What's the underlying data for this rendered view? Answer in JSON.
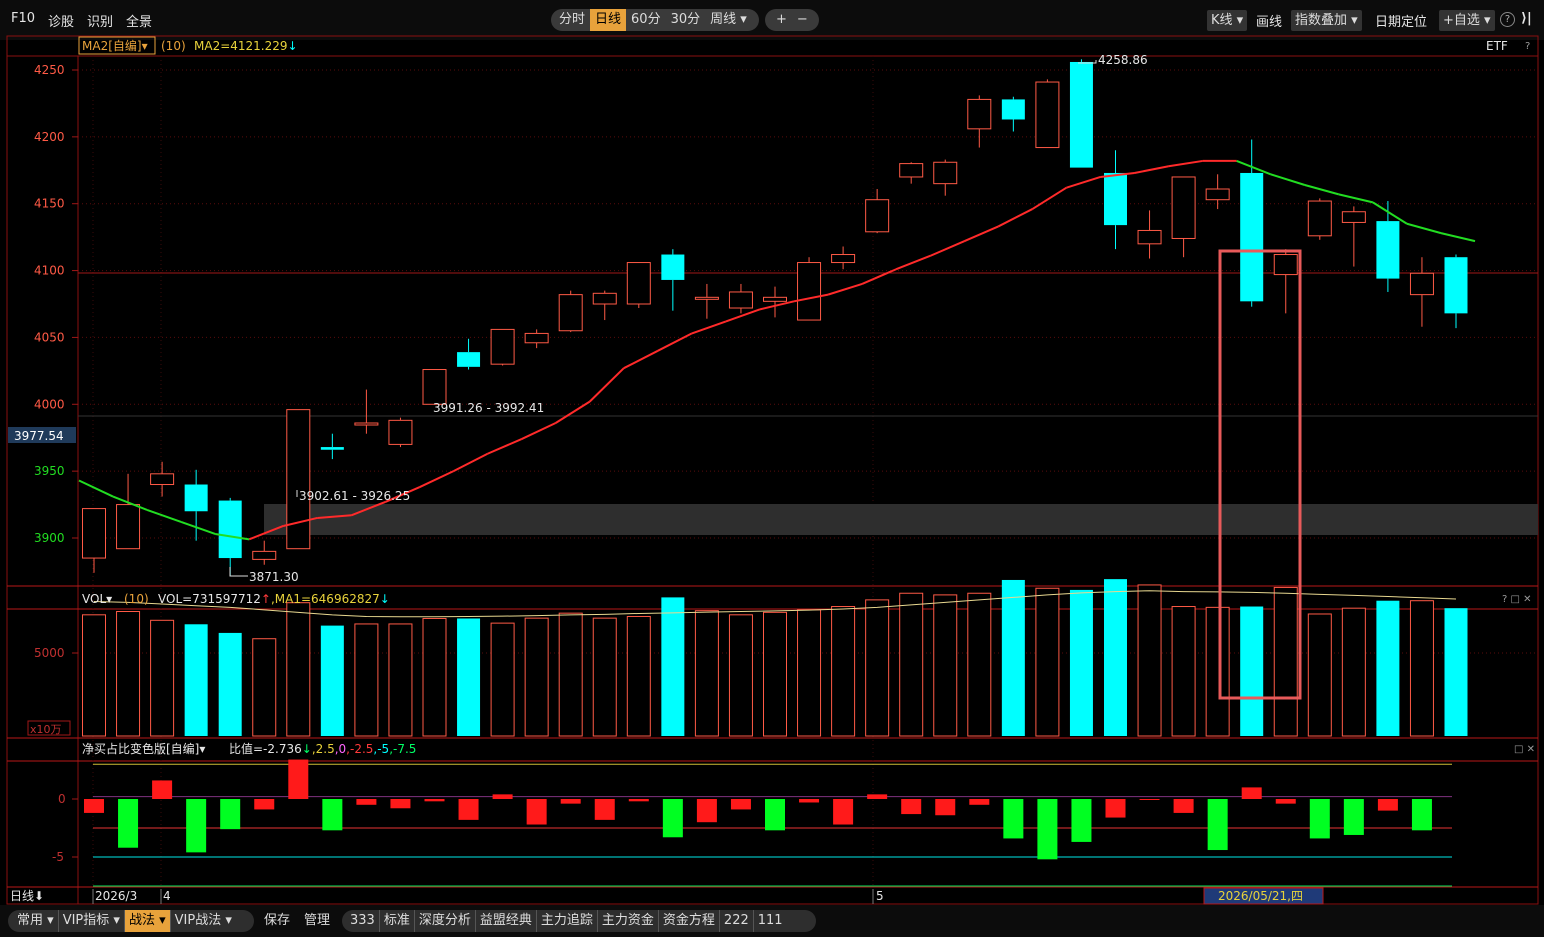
{
  "toolbar": {
    "left_items": [
      "F10",
      "诊股",
      "识别",
      "全景"
    ],
    "periods": [
      "分时",
      "日线",
      "60分",
      "30分",
      "周线"
    ],
    "active_period": "日线",
    "plus": "+",
    "minus": "−",
    "kline_btn": "K线",
    "draw_btn": "画线",
    "overlay_btn": "指数叠加",
    "date_locate": "日期定位",
    "watchlist_btn": "+自选",
    "help": "?",
    "collapse": "⟩|"
  },
  "main_panel": {
    "indicator_name": "MA2[自编]",
    "indicator_param": "(10)",
    "indicator_value": "MA2=4121.229",
    "indicator_arrow": "↓",
    "etf_label": "ETF",
    "help": "?",
    "current_price_label": "3977.54",
    "annotations": {
      "high": "4258.86",
      "low": "3871.30",
      "zone1": "3902.61 - 3926.25",
      "zone2": "3991.26 - 3992.41"
    }
  },
  "vol_panel": {
    "name": "VOL",
    "param": "(10)",
    "vol_value": "VOL=731597712",
    "vol_arrow": "↑",
    "ma_value": ",MA1=646962827",
    "ma_arrow": "↓",
    "unit": "x10万",
    "controls": "? □ ✕"
  },
  "net_panel": {
    "name": "净买占比变色版[自编]",
    "ratio_label": "比值=-2.736",
    "ratio_arrow": "↓",
    "levels": [
      ",2.5",
      ",0",
      ",-2.5",
      ",-5",
      ",-7.5"
    ],
    "controls": "□ ✕"
  },
  "time_axis": {
    "period_label": "日线",
    "labels": [
      "2026/3",
      "4",
      "5"
    ],
    "cursor_date": "2026/05/21,四"
  },
  "bottom_bar": {
    "left": [
      "常用",
      "VIP指标",
      "战法",
      "VIP战法"
    ],
    "active": "战法",
    "middle": [
      "保存",
      "管理"
    ],
    "tabs": [
      "333",
      "标准",
      "深度分析",
      "益盟经典",
      "主力追踪",
      "主力资金",
      "资金方程",
      "222",
      "111"
    ]
  },
  "colors": {
    "up": "#ff5a46",
    "down": "#00ffff",
    "ma_up": "#ff2a2a",
    "ma_down": "#22dd22",
    "accent": "#e8a23b",
    "grid": "#5a0c0c",
    "frame": "#a61515"
  },
  "chart_data": [
    {
      "type": "candlestick",
      "dates_axis": [
        "2026/3",
        "4",
        "5"
      ],
      "ylim": [
        3860,
        4265
      ],
      "yticks": [
        3900,
        3950,
        4000,
        4050,
        4100,
        4150,
        4200,
        4250
      ],
      "ohlc": [
        [
          3885,
          3922,
          3874,
          3882
        ],
        [
          3892,
          3925,
          3892,
          3948
        ],
        [
          3940,
          3948,
          3931,
          3957
        ],
        [
          3940,
          3920,
          3898,
          3951
        ],
        [
          3928,
          3885,
          3872,
          3930
        ],
        [
          3884,
          3890,
          3880,
          3898
        ],
        [
          3892,
          3996,
          3892,
          3996
        ],
        [
          3968,
          3966,
          3959,
          3978
        ],
        [
          3985,
          3986,
          3978,
          4011
        ],
        [
          3970,
          3988,
          3968,
          3990
        ],
        [
          4000,
          4026,
          4000,
          4026
        ],
        [
          4039,
          4028,
          4026,
          4049
        ],
        [
          4030,
          4056,
          4029,
          4056
        ],
        [
          4046,
          4053,
          4042,
          4056
        ],
        [
          4055,
          4082,
          4054,
          4085
        ],
        [
          4075,
          4083,
          4063,
          4085
        ],
        [
          4075,
          4106,
          4072,
          4106
        ],
        [
          4112,
          4093,
          4070,
          4116
        ],
        [
          4080,
          4080,
          4064,
          4090
        ],
        [
          4072,
          4084,
          4068,
          4090
        ],
        [
          4077,
          4080,
          4065,
          4088
        ],
        [
          4063,
          4106,
          4063,
          4110
        ],
        [
          4106,
          4112,
          4101,
          4118
        ],
        [
          4129,
          4153,
          4128,
          4161
        ],
        [
          4170,
          4180,
          4165,
          4181
        ],
        [
          4165,
          4181,
          4156,
          4183
        ],
        [
          4206,
          4228,
          4192,
          4231
        ],
        [
          4228,
          4213,
          4204,
          4230
        ],
        [
          4192,
          4241,
          4192,
          4243
        ],
        [
          4256,
          4177,
          4177,
          4258
        ],
        [
          4173,
          4134,
          4116,
          4190
        ],
        [
          4120,
          4130,
          4109,
          4145
        ],
        [
          4124,
          4170,
          4110,
          4170
        ],
        [
          4153,
          4161,
          4146,
          4172
        ],
        [
          4173,
          4077,
          4073,
          4198
        ],
        [
          4097,
          4112,
          4068,
          4116
        ],
        [
          4126,
          4152,
          4123,
          4154
        ],
        [
          4136,
          4144,
          4103,
          4148
        ],
        [
          4137,
          4094,
          4084,
          4152
        ],
        [
          4082,
          4098,
          4058,
          4110
        ],
        [
          4110,
          4068,
          4057,
          4112
        ]
      ],
      "ma": [
        3943,
        3931,
        3921,
        3912,
        3903,
        3899,
        3909,
        3915,
        3917,
        3927,
        3938,
        3950,
        3963,
        3974,
        3986,
        4002,
        4027,
        4040,
        4053,
        4062,
        4071,
        4077,
        4082,
        4090,
        4101,
        4111,
        4122,
        4133,
        4146,
        4162,
        4170,
        4173,
        4178,
        4182,
        4182,
        4172,
        4164,
        4157,
        4151,
        4135,
        4128,
        4122
      ]
    },
    {
      "type": "bar",
      "name": "VOL",
      "unit": "x10万",
      "yticks": [
        5000
      ],
      "values": [
        7300,
        7500,
        6970,
        6730,
        6210,
        5860,
        8030,
        6650,
        6750,
        6750,
        7080,
        7080,
        6800,
        7100,
        7400,
        7100,
        7200,
        8350,
        7550,
        7300,
        7450,
        7600,
        7800,
        8200,
        8600,
        8500,
        8600,
        9400,
        8900,
        8800,
        9450,
        9100,
        7800,
        7750,
        7800,
        8950,
        7350,
        7700,
        8150,
        8150,
        7700,
        9100
      ],
      "ma": [
        8100,
        8050,
        7950,
        7850,
        7750,
        7600,
        7450,
        7300,
        7200,
        7180,
        7180,
        7200,
        7220,
        7250,
        7300,
        7330,
        7380,
        7420,
        7460,
        7500,
        7540,
        7580,
        7650,
        7750,
        7900,
        8050,
        8200,
        8350,
        8500,
        8620,
        8700,
        8750,
        8700,
        8680,
        8650,
        8600,
        8530,
        8470,
        8400,
        8330,
        8250,
        8250
      ]
    },
    {
      "type": "bar",
      "name": "净买占比",
      "yticks": [
        0,
        -5
      ],
      "values": [
        -1.2,
        -4.2,
        1.6,
        -4.6,
        -2.6,
        -0.9,
        3.4,
        -2.7,
        -0.5,
        -0.8,
        -0.2,
        -1.8,
        0.4,
        -2.2,
        -0.4,
        -1.8,
        -0.2,
        -3.3,
        -2.0,
        -0.9,
        -2.7,
        -0.3,
        -2.2,
        0.4,
        -1.3,
        -1.4,
        -0.5,
        -3.4,
        -5.2,
        -3.7,
        -1.6,
        0.0,
        -1.2,
        -4.4,
        1.0,
        -0.4,
        -3.4,
        -3.1,
        -1.0,
        -2.7
      ],
      "lines": [
        3.0,
        0.2,
        -2.5,
        -5.0,
        -7.5
      ]
    }
  ]
}
